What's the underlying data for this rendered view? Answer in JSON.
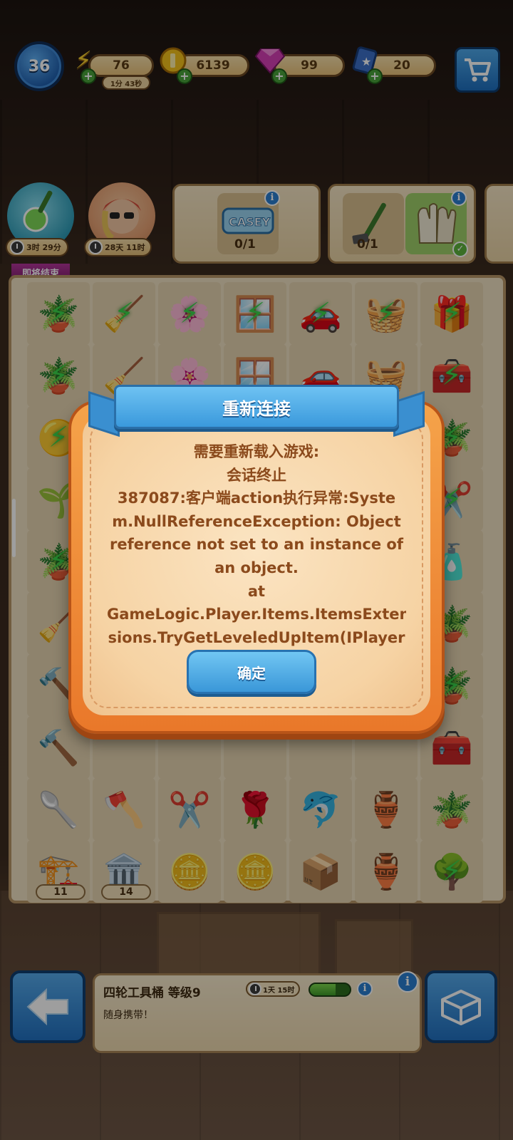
{
  "hud": {
    "level": "36",
    "energy": {
      "value": "76",
      "timer": "1分 43秒",
      "icon": "lightning-icon"
    },
    "coins": {
      "value": "6139",
      "icon": "coin-icon"
    },
    "gems": {
      "value": "99",
      "icon": "gem-icon"
    },
    "cards": {
      "value": "20",
      "icon": "card-icon"
    },
    "plus_label": "+",
    "cart_icon": "cart-icon"
  },
  "events": {
    "event1": {
      "timer": "3时 29分"
    },
    "event2": {
      "timer": "28天 11时"
    },
    "ending_tag": "即将结束"
  },
  "orders": {
    "order1": {
      "count": "0/1"
    },
    "order2": {
      "count": "0/1"
    },
    "info_label": "i",
    "check_label": "✓"
  },
  "board": {
    "badges": {
      "b1": "11",
      "b2": "14"
    }
  },
  "dialog": {
    "title": "重新连接",
    "lines": [
      "需要重新载入游戏:",
      "会话终止",
      "387087:客户端action执行异常:Syste",
      "m.NullReferenceException: Object",
      "reference not set to an instance of",
      "an object.",
      "at",
      "GameLogic.Player.Items.ItemsExten",
      "sions.TryGetLeveledUpItem(IPlayer"
    ],
    "ok_label": "确定"
  },
  "bottom": {
    "item_name": "四轮工具桶 等级9",
    "item_timer": "1天 15时",
    "item_desc": "随身携带！",
    "info_label": "i",
    "mini_bar_fill": 0.65
  },
  "colors": {
    "accent_blue": "#3a99dc",
    "dialog_orange": "#e9782a",
    "text_brown": "#8b4a1c"
  }
}
